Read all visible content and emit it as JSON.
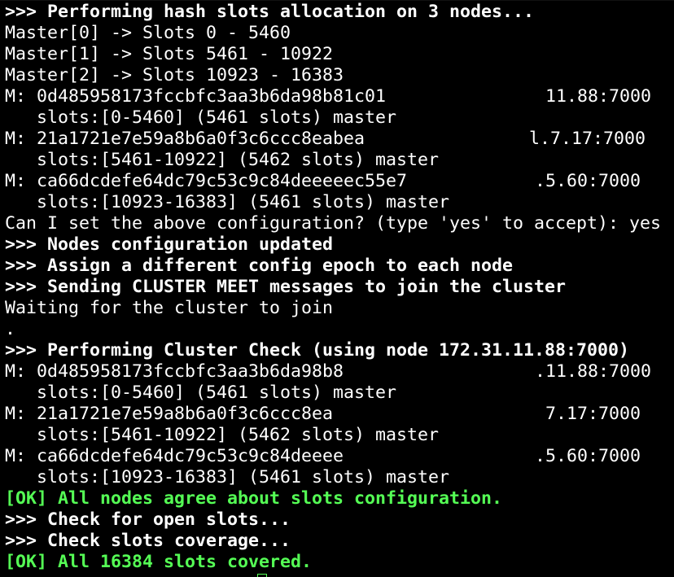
{
  "terminal": {
    "colors": {
      "background": "#000000",
      "text": "#ffffff",
      "ok_text": "#55ff55"
    },
    "lines": [
      {
        "text": ">>> Performing hash slots allocation on 3 nodes...",
        "style": "bold"
      },
      {
        "text": "Master[0] -> Slots 0 - 5460",
        "style": "normal"
      },
      {
        "text": "Master[1] -> Slots 5461 - 10922",
        "style": "normal"
      },
      {
        "text": "Master[2] -> Slots 10923 - 16383",
        "style": "normal"
      },
      {
        "left": "M: 0d485958173fccbfc3aa3b6da98b81c01",
        "right": "11.88:7000",
        "style": "node"
      },
      {
        "text": "   slots:[0-5460] (5461 slots) master",
        "style": "normal"
      },
      {
        "left": "M: 21a1721e7e59a8b6a0f3c6ccc8eabea",
        "right": "l.7.17:7000",
        "style": "node"
      },
      {
        "text": "   slots:[5461-10922] (5462 slots) master",
        "style": "normal"
      },
      {
        "left": "M: ca66dcdefe64dc79c53c9c84deeeeec55e7",
        "right": ".5.60:7000",
        "style": "node"
      },
      {
        "text": "   slots:[10923-16383] (5461 slots) master",
        "style": "normal"
      },
      {
        "text": "Can I set the above configuration? (type 'yes' to accept): yes",
        "style": "normal"
      },
      {
        "text": ">>> Nodes configuration updated",
        "style": "bold"
      },
      {
        "text": ">>> Assign a different config epoch to each node",
        "style": "bold"
      },
      {
        "text": ">>> Sending CLUSTER MEET messages to join the cluster",
        "style": "bold"
      },
      {
        "text": "Waiting for the cluster to join",
        "style": "normal"
      },
      {
        "text": ".",
        "style": "normal"
      },
      {
        "text": ">>> Performing Cluster Check (using node 172.31.11.88:7000)",
        "style": "bold"
      },
      {
        "left": "M: 0d485958173fccbfc3aa3b6da98b8",
        "right": ".11.88:7000",
        "style": "node"
      },
      {
        "text": "   slots:[0-5460] (5461 slots) master",
        "style": "normal"
      },
      {
        "left": "M: 21a1721e7e59a8b6a0f3c6ccc8ea",
        "right": "7.17:7000",
        "style": "node"
      },
      {
        "text": "   slots:[5461-10922] (5462 slots) master",
        "style": "normal"
      },
      {
        "left": "M: ca66dcdefe64dc79c53c9c84deeee",
        "right": ".5.60:7000",
        "style": "node"
      },
      {
        "text": "   slots:[10923-16383] (5461 slots) master",
        "style": "normal"
      },
      {
        "text": "[OK] All nodes agree about slots configuration.",
        "style": "ok"
      },
      {
        "text": ">>> Check for open slots...",
        "style": "bold"
      },
      {
        "text": ">>> Check slots coverage...",
        "style": "bold"
      },
      {
        "text": "[OK] All 16384 slots covered.",
        "style": "ok"
      }
    ]
  }
}
